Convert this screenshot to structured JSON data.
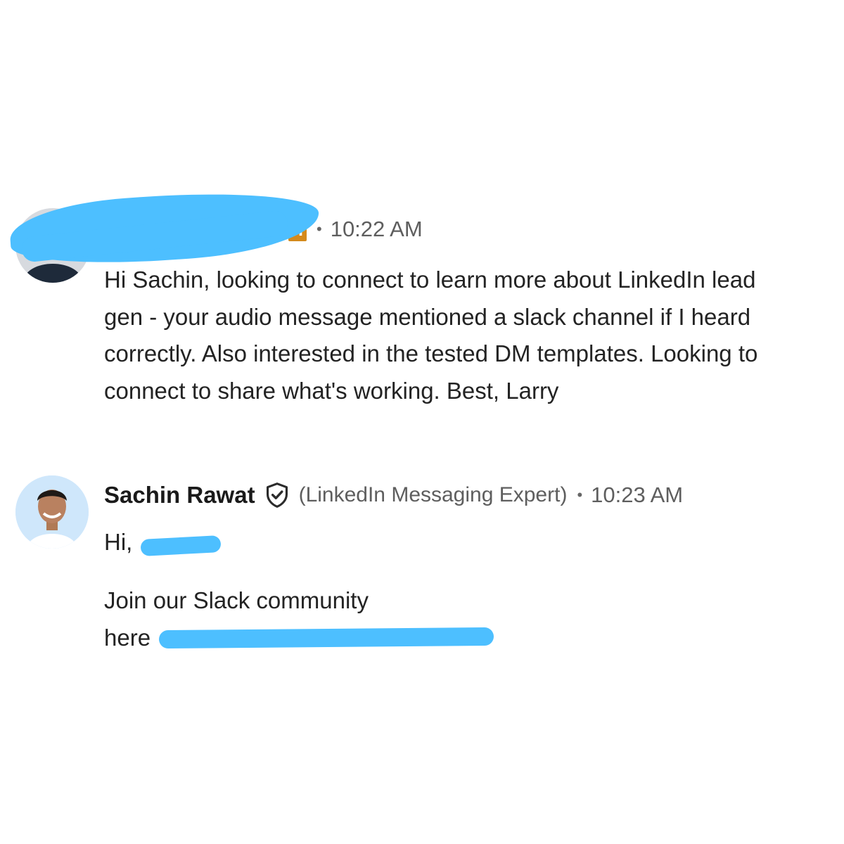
{
  "messages": [
    {
      "sender": {
        "name": "",
        "redacted": true
      },
      "timestamp": "10:22 AM",
      "body": "Hi Sachin, looking to connect to learn more about LinkedIn lead gen - your audio message mentioned a slack channel if I heard correctly. Also interested in the tested DM templates. Looking to connect to share what's working. Best, Larry"
    },
    {
      "sender": {
        "name": "Sachin Rawat",
        "headline": "(LinkedIn Messaging Expert)",
        "verified_icon": "shield-check-icon"
      },
      "timestamp": "10:23 AM",
      "greeting": "Hi,",
      "body_line1": "Join our Slack community",
      "body_line2_prefix": "here",
      "link_redacted": true
    }
  ],
  "colors": {
    "redaction": "#4dbfff",
    "link": "#6b4fbb",
    "company_badge": "#d48a1c",
    "secondary_text": "#5e5e5e"
  }
}
